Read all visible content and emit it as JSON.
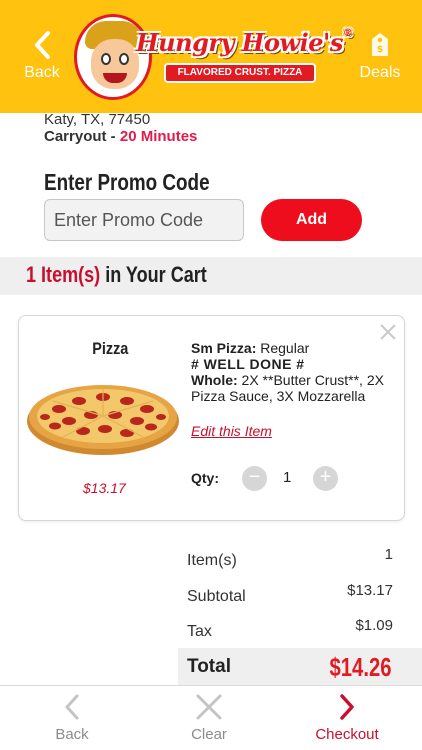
{
  "header": {
    "back_label": "Back",
    "deals_label": "Deals",
    "brand": "Hungry Howie's",
    "brand_mark": "®",
    "tagline": "FLAVORED CRUST. PIZZA",
    "colors": {
      "bar": "#ffc20e",
      "brand_red": "#e21b23"
    }
  },
  "store": {
    "address_line": "Katy, TX, 77450",
    "mode_label": "Carryout",
    "mode_sep": " - ",
    "time": "20 Minutes"
  },
  "promo": {
    "title": "Enter Promo Code",
    "placeholder": "Enter Promo Code",
    "value": "",
    "add_label": "Add"
  },
  "cart": {
    "count_text": "1 Item(s)",
    "title_suffix": " in Your Cart",
    "items": [
      {
        "name": "Pizza",
        "price": "$13.17",
        "size_label": "Sm Pizza:",
        "size_value": "Regular",
        "note": "# WELL DONE #",
        "toppings_label": "Whole:",
        "toppings": "2X **Butter Crust**, 2X Pizza Sauce, 3X Mozzarella",
        "edit_label": "Edit this Item",
        "qty_label": "Qty:",
        "qty": "1",
        "minus_icon": "minus-circle-icon",
        "plus_icon": "plus-circle-icon",
        "remove_icon": "close-icon"
      }
    ]
  },
  "totals": {
    "items_label": "Item(s)",
    "items_value": "1",
    "subtotal_label": "Subtotal",
    "subtotal_value": "$13.17",
    "tax_label": "Tax",
    "tax_value": "$1.09",
    "total_label": "Total",
    "total_value": "$14.26"
  },
  "bottom_nav": {
    "back_label": "Back",
    "clear_label": "Clear",
    "checkout_label": "Checkout",
    "active_color": "#c8102e"
  }
}
